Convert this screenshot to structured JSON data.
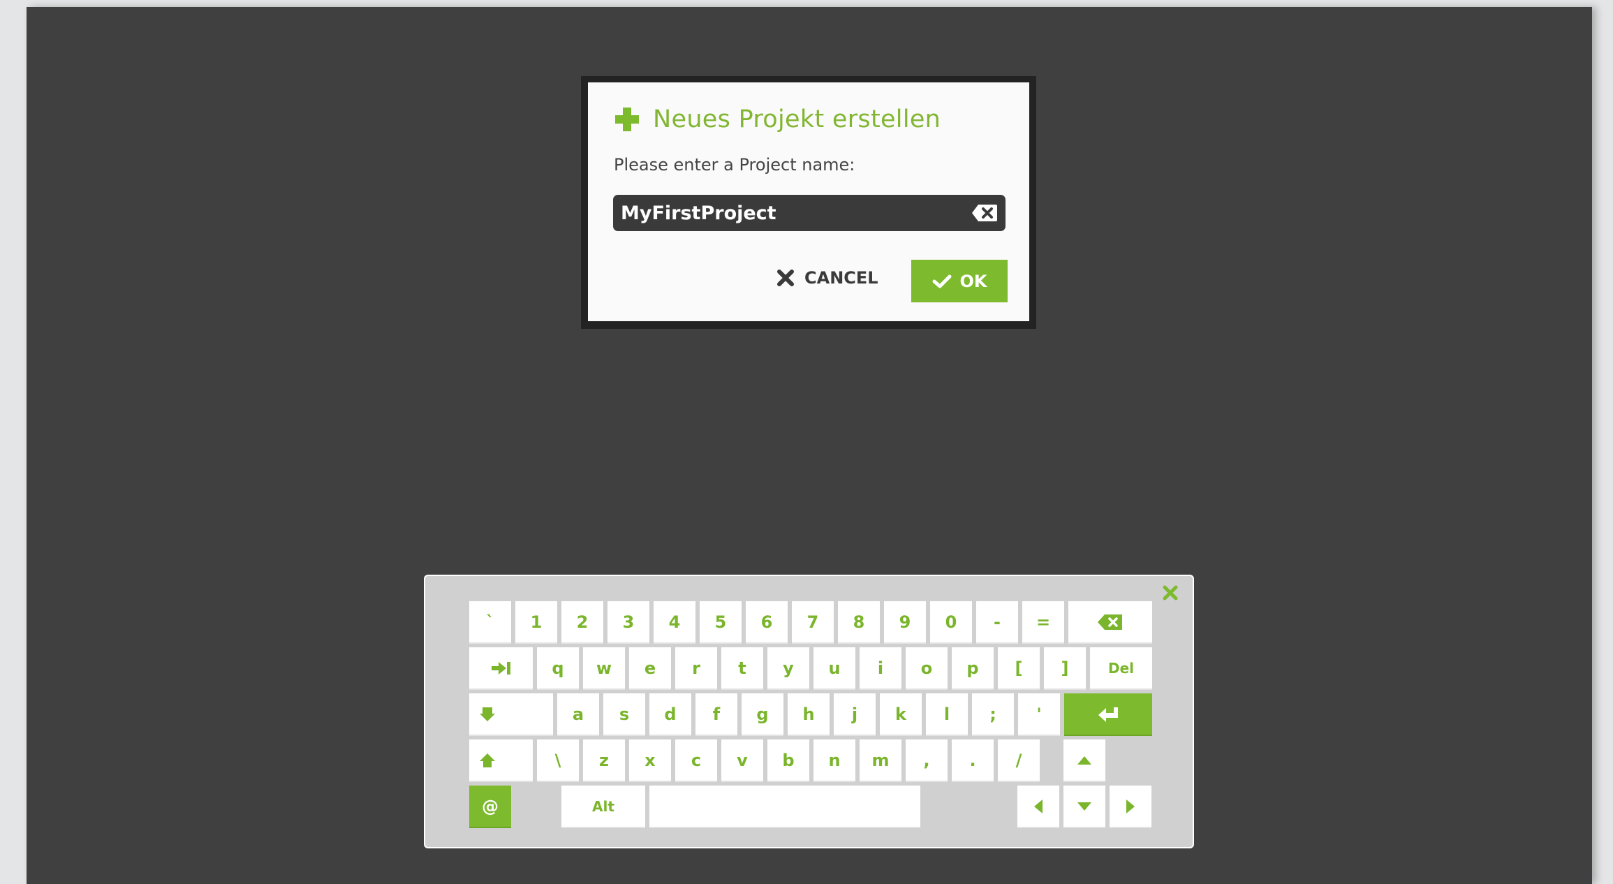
{
  "dialog": {
    "title": "Neues Projekt erstellen",
    "prompt": "Please enter a Project name:",
    "input_value": "MyFirstProject",
    "cancel_label": "CANCEL",
    "ok_label": "OK"
  },
  "keyboard": {
    "rows": [
      [
        "`",
        "1",
        "2",
        "3",
        "4",
        "5",
        "6",
        "7",
        "8",
        "9",
        "0",
        "-",
        "=",
        "backspace-icon"
      ],
      [
        "tab-icon",
        "q",
        "w",
        "e",
        "r",
        "t",
        "y",
        "u",
        "i",
        "o",
        "p",
        "[",
        "]",
        "Del"
      ],
      [
        "caps-lock-icon",
        "a",
        "s",
        "d",
        "f",
        "g",
        "h",
        "j",
        "k",
        "l",
        ";",
        "'",
        "enter-icon"
      ],
      [
        "shift-icon",
        "\\",
        "z",
        "x",
        "c",
        "v",
        "b",
        "n",
        "m",
        ",",
        ".",
        "/",
        "arrow-up-icon"
      ],
      [
        "@",
        "Alt",
        "space",
        "arrow-left-icon",
        "arrow-down-icon",
        "arrow-right-icon"
      ]
    ]
  },
  "colors": {
    "accent": "#7dba2d",
    "screen": "#404040",
    "keyboard_bg": "#d0d0d0"
  }
}
